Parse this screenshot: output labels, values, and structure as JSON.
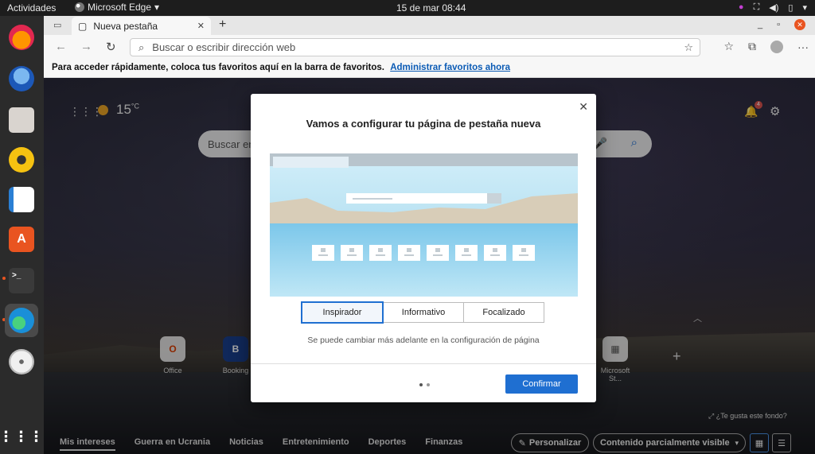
{
  "topbar": {
    "activities": "Actividades",
    "app_name": "Microsoft Edge",
    "app_menu_caret": "▾",
    "clock": "15 de mar  08:44"
  },
  "dock": {
    "items": [
      "firefox-icon",
      "thunderbird-icon",
      "files-icon",
      "rhythmbox-icon",
      "writer-icon",
      "software-icon",
      "terminal-icon",
      "edge-icon",
      "dvd-icon",
      "apps-grid-icon"
    ]
  },
  "browser": {
    "tab_title": "Nueva pestaña",
    "new_tab": "+",
    "address_placeholder": "Buscar o escribir dirección web",
    "favbar_text": "Para acceder rápidamente, coloca tus favoritos aquí en la barra de favoritos.",
    "favbar_link": "Administrar favoritos ahora"
  },
  "ntp": {
    "temperature": "15",
    "temp_unit": "°C",
    "notification_count": "4",
    "search_placeholder": "Buscar en",
    "tiles": [
      {
        "label": "Office",
        "glyph": ""
      },
      {
        "label": "Booking",
        "glyph": "B"
      },
      {
        "label": "Microsoft St...",
        "glyph": ""
      }
    ],
    "bg_question": "¿Te gusta este fondo?",
    "nav": [
      "Mis intereses",
      "Guerra en Ucrania",
      "Noticias",
      "Entretenimiento",
      "Deportes",
      "Finanzas"
    ],
    "personalize": "Personalizar",
    "content_select": "Contenido parcialmente visible"
  },
  "modal": {
    "title": "Vamos a configurar tu página de pestaña nueva",
    "options": [
      "Inspirador",
      "Informativo",
      "Focalizado"
    ],
    "selected": "Inspirador",
    "hint": "Se puede cambiar más adelante en la configuración de página",
    "confirm": "Confirmar",
    "close": "✕"
  },
  "colors": {
    "accent": "#1f6fd1",
    "ubuntu_orange": "#e95420"
  }
}
